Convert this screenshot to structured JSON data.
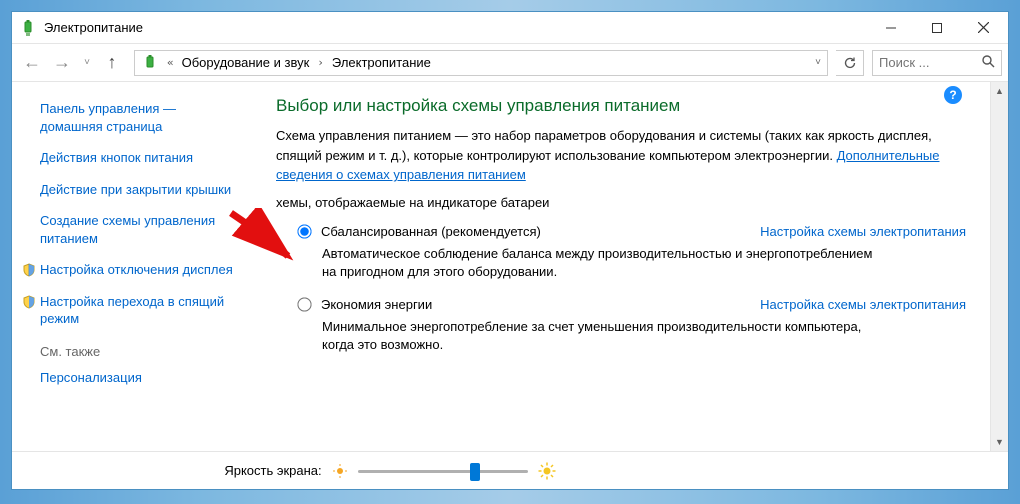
{
  "title": "Электропитание",
  "breadcrumb": {
    "seg1": "Оборудование и звук",
    "seg2": "Электропитание"
  },
  "search": {
    "placeholder": "Поиск ..."
  },
  "sidebar": {
    "home": "Панель управления — домашняя страница",
    "links": [
      "Действия кнопок питания",
      "Действие при закрытии крышки",
      "Создание схемы управления питанием",
      "Настройка отключения дисплея",
      "Настройка перехода в спящий режим"
    ],
    "seeAlso": "См. также",
    "personalize": "Персонализация"
  },
  "main": {
    "heading": "Выбор или настройка схемы управления питанием",
    "desc1": "Схема управления питанием — это набор параметров оборудования и системы (таких как яркость дисплея, спящий режим и т. д.), которые контролируют использование компьютером электроэнергии. ",
    "descLink": "Дополнительные сведения о схемах управления питанием",
    "groupHeader": "хемы, отображаемые на индикаторе батареи",
    "plans": [
      {
        "name": "Сбалансированная (рекомендуется)",
        "desc": "Автоматическое соблюдение баланса между производительностью и энергопотреблением на пригодном для этого оборудовании.",
        "checked": true,
        "setting": "Настройка схемы электропитания"
      },
      {
        "name": "Экономия энергии",
        "desc": "Минимальное энергопотребление за счет уменьшения производительности компьютера, когда это возможно.",
        "checked": false,
        "setting": "Настройка схемы электропитания"
      }
    ]
  },
  "footer": {
    "label": "Яркость экрана:"
  },
  "slider": {
    "percent": 70
  }
}
